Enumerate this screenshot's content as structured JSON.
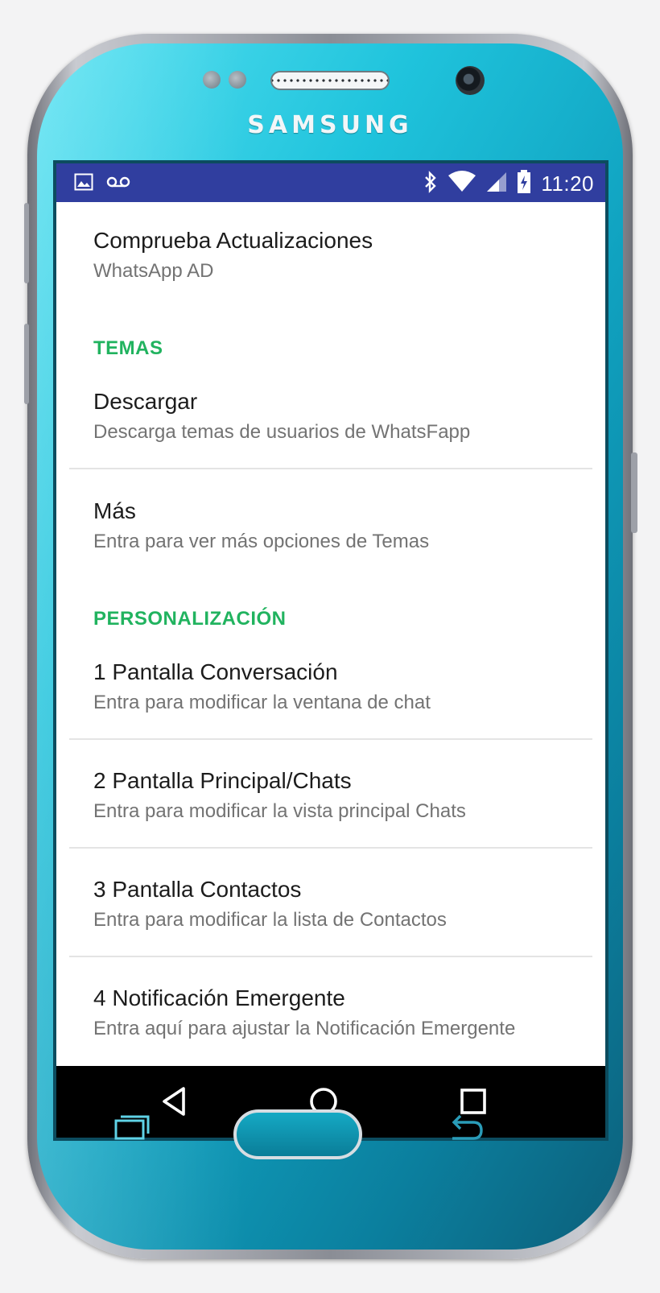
{
  "device": {
    "brand": "SAMSUNG",
    "colors": {
      "body": "#10a2c0",
      "statusbar": "#303e9f",
      "accent": "#21b35f"
    }
  },
  "statusbar": {
    "time": "11:20",
    "left_icons": [
      "image-icon",
      "voicemail-icon"
    ],
    "right_icons": [
      "bluetooth-icon",
      "wifi-icon",
      "signal-icon",
      "battery-charging-icon"
    ]
  },
  "settings": {
    "check_updates": {
      "title": "Comprueba Actualizaciones",
      "summary": "WhatsApp AD"
    },
    "temas_header": "TEMAS",
    "descargar": {
      "title": "Descargar",
      "summary": "Descarga temas de usuarios de WhatsFapp"
    },
    "mas": {
      "title": "Más",
      "summary": "Entra para ver más opciones de Temas"
    },
    "personalizacion_header": "PERSONALIZACIÓN",
    "pantalla_conversacion": {
      "title": "1 Pantalla Conversación",
      "summary": "Entra para modificar la ventana de chat"
    },
    "pantalla_principal": {
      "title": "2 Pantalla Principal/Chats",
      "summary": "Entra para modificar la vista principal Chats"
    },
    "pantalla_contactos": {
      "title": "3 Pantalla Contactos",
      "summary": "Entra para modificar la lista de Contactos"
    },
    "notificacion_emergente": {
      "title": "4 Notificación Emergente",
      "summary": "Entra aquí para ajustar la Notificación Emergente"
    }
  },
  "navbar": {
    "buttons": [
      "back-icon",
      "home-icon",
      "recents-icon"
    ]
  }
}
